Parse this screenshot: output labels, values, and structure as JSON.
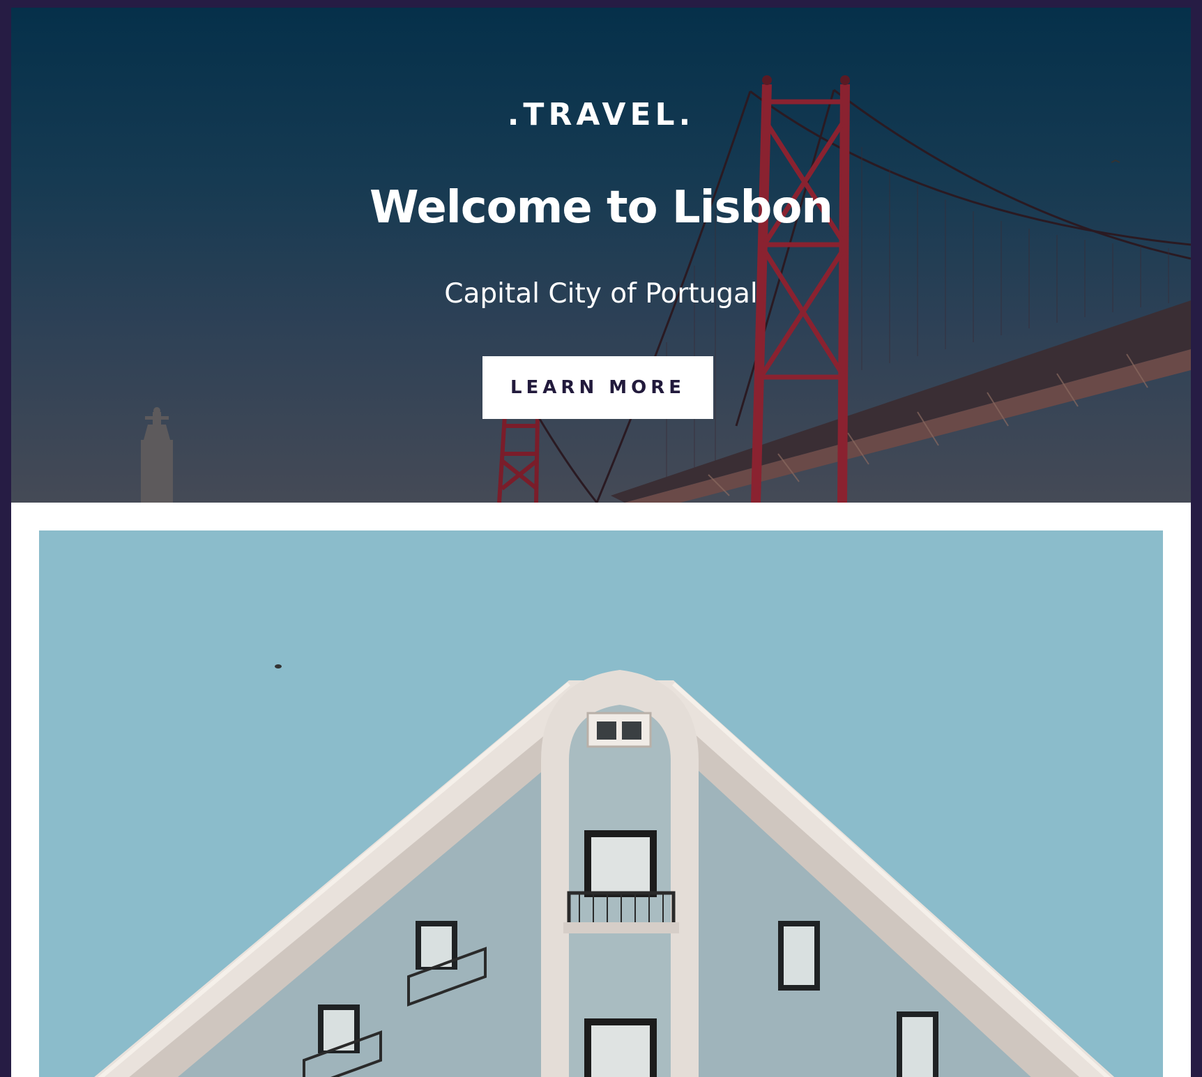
{
  "hero": {
    "brand": ".TRAVEL.",
    "title": "Welcome to Lisbon",
    "subtitle": "Capital City of Portugal",
    "cta_label": "LEARN MORE"
  },
  "colors": {
    "page_border": "#261c44",
    "button_text": "#221a3c",
    "bridge_red": "#8a2230",
    "sky_top": "#05304a",
    "photo_sky": "#8bbccb"
  },
  "images": {
    "hero_background": "bridge-photo",
    "feature_photo": "building-photo"
  }
}
